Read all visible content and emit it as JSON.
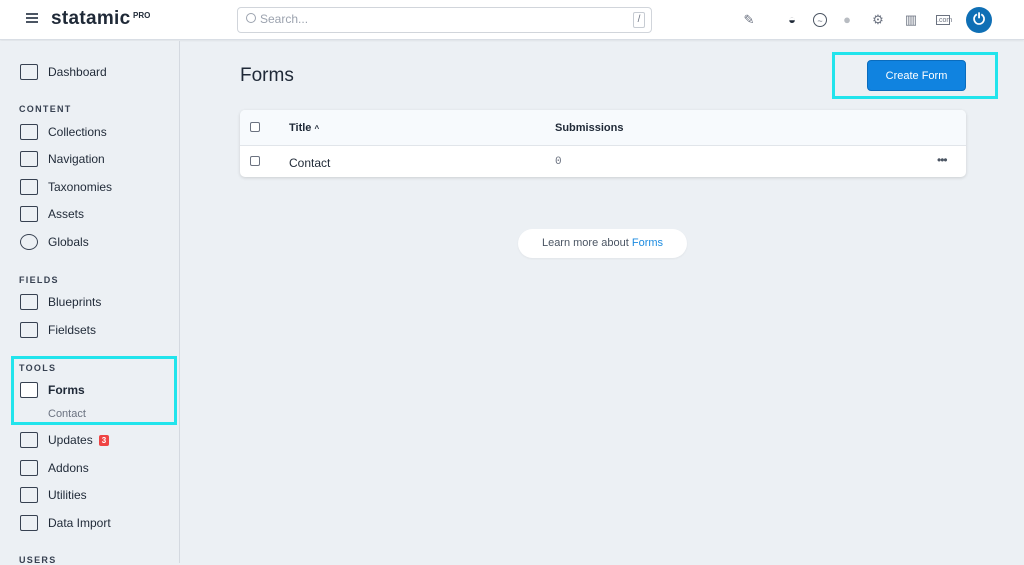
{
  "header": {
    "logo": "statamic",
    "edition": "PRO",
    "search_placeholder": "Search...",
    "search_shortcut": "/",
    "icons": [
      "pin-icon",
      "dark-mode-icon",
      "pulse-icon",
      "status-dot-icon",
      "settings-icon",
      "docs-book-icon",
      "site-icon"
    ]
  },
  "sidebar": {
    "dashboard": "Dashboard",
    "content": {
      "heading": "CONTENT",
      "items": [
        "Collections",
        "Navigation",
        "Taxonomies",
        "Assets",
        "Globals"
      ]
    },
    "fields": {
      "heading": "FIELDS",
      "items": [
        "Blueprints",
        "Fieldsets"
      ]
    },
    "tools": {
      "heading": "TOOLS",
      "forms": "Forms",
      "forms_child": "Contact",
      "updates": "Updates",
      "updates_badge": "3",
      "addons": "Addons",
      "utilities": "Utilities",
      "data_import": "Data Import"
    },
    "users": {
      "heading": "USERS"
    }
  },
  "main": {
    "title": "Forms",
    "create_button": "Create Form",
    "table": {
      "columns": [
        "Title",
        "Submissions"
      ],
      "sort_indicator": "^",
      "rows": [
        {
          "title": "Contact",
          "submissions": "0"
        }
      ]
    },
    "learn_prefix": "Learn more about",
    "learn_link": "Forms"
  },
  "colors": {
    "accent": "#1083e0",
    "highlight": "#22e4ec",
    "badge": "#ef4444"
  }
}
